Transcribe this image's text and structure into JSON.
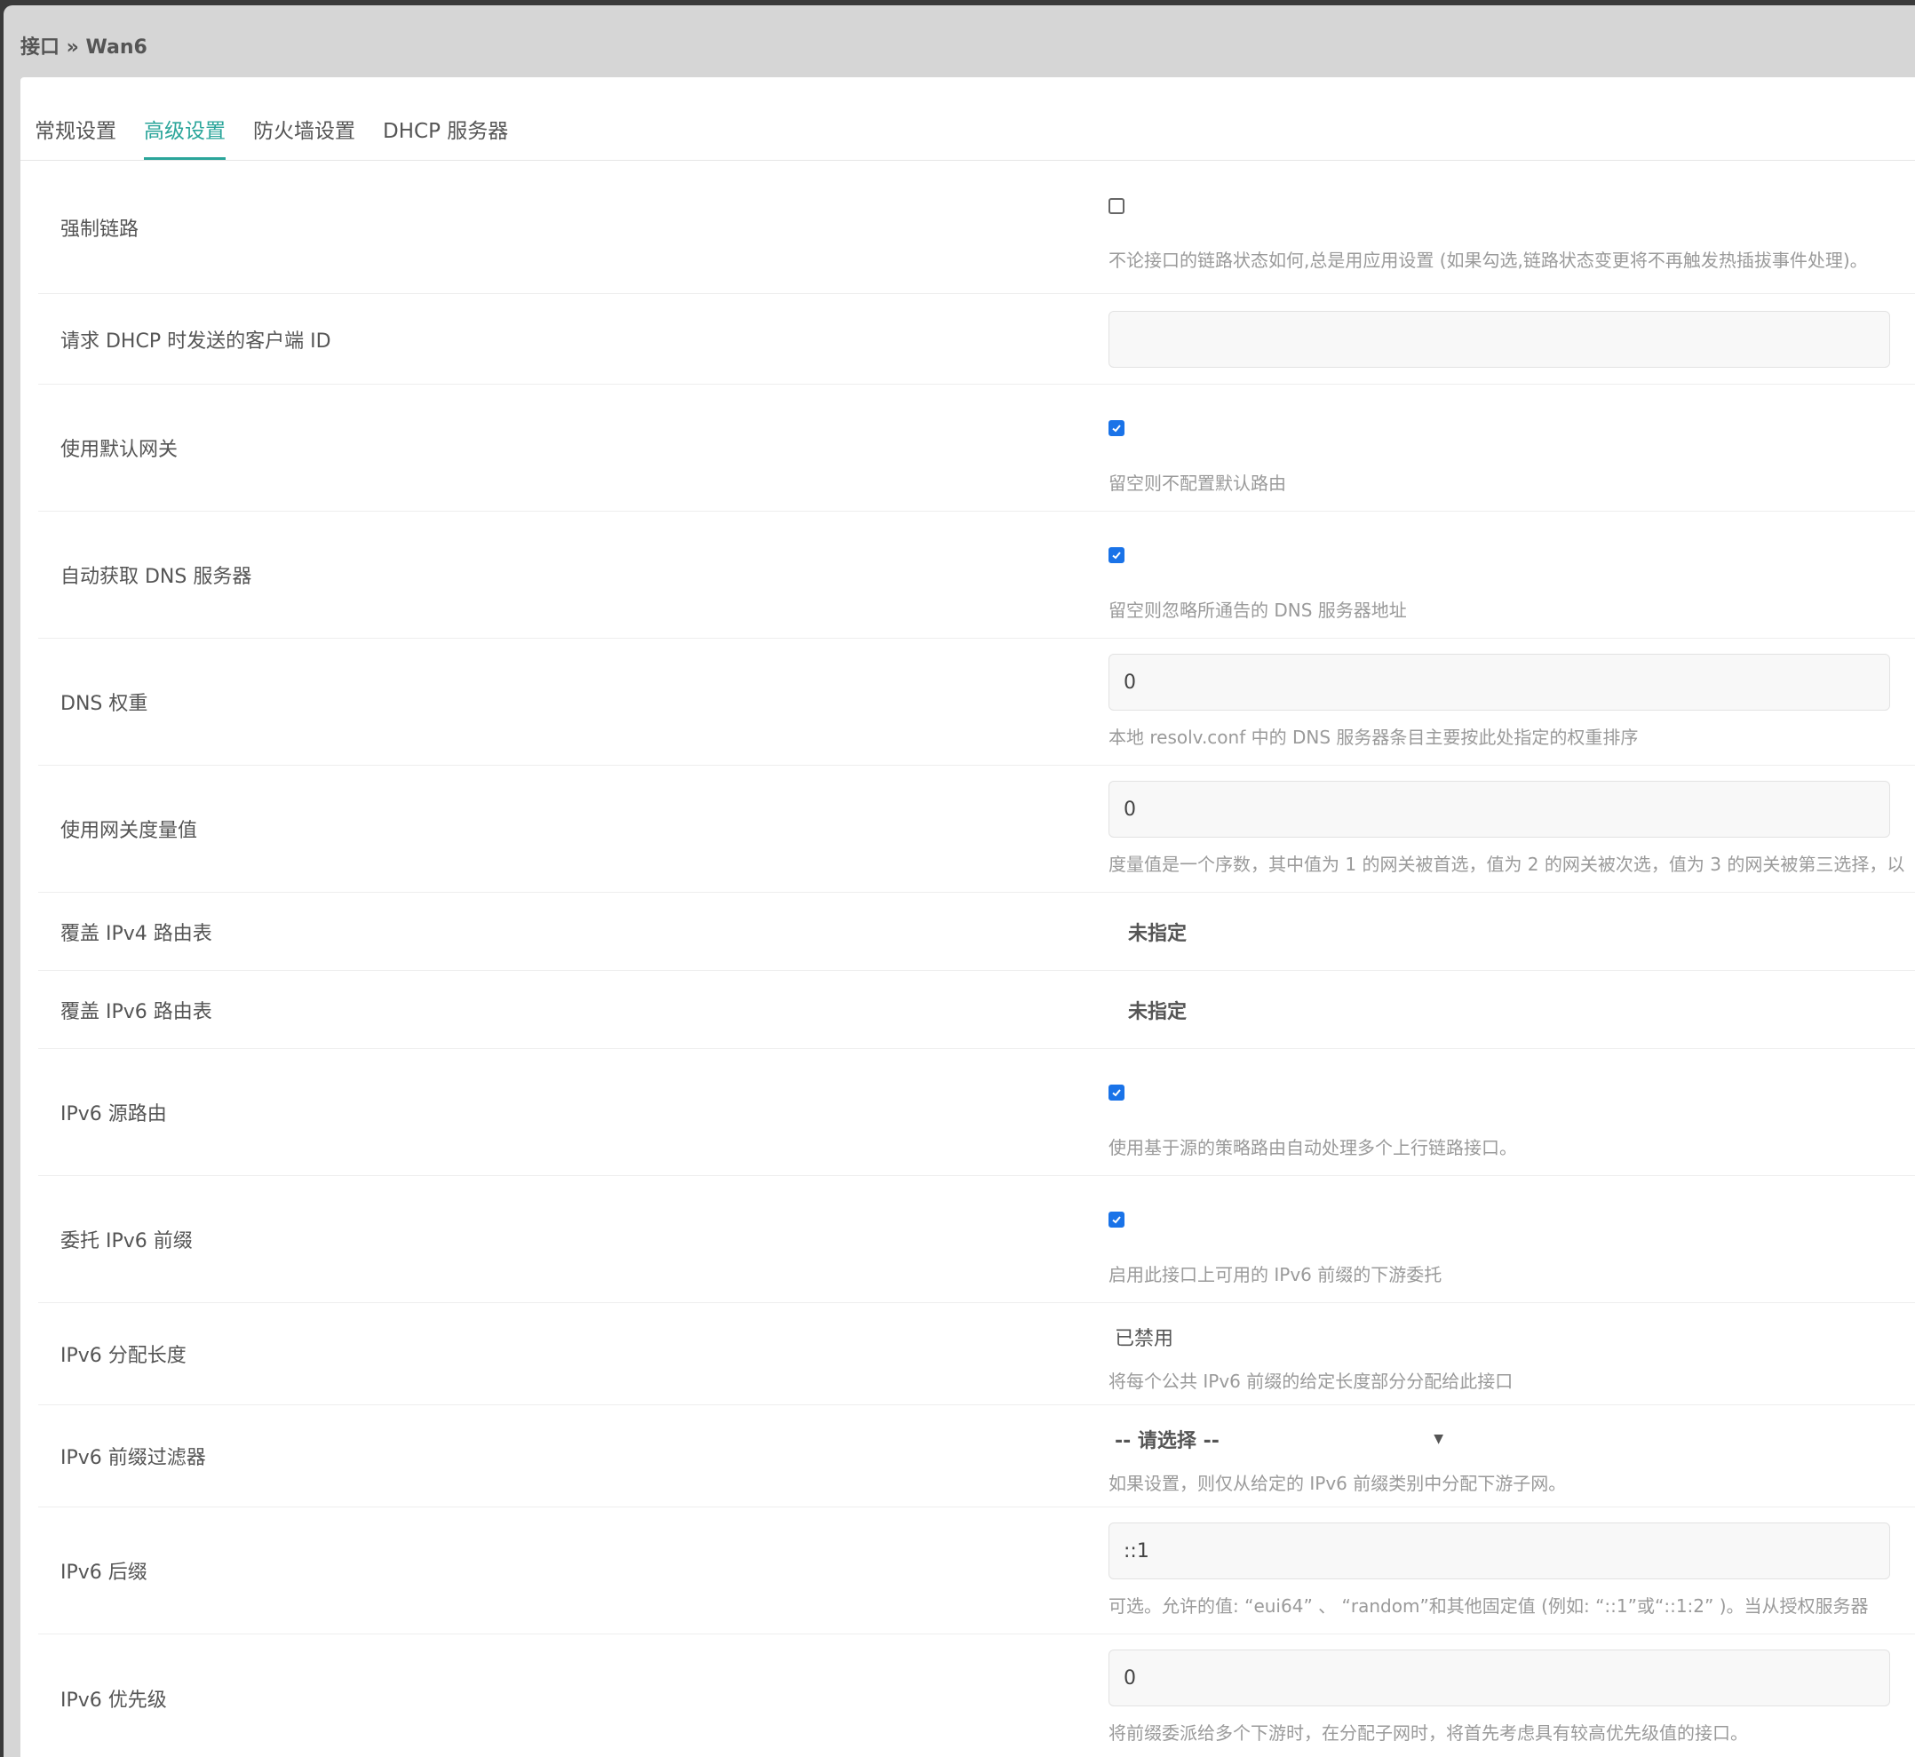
{
  "header": {
    "breadcrumb": "接口 » Wan6"
  },
  "tabs": [
    {
      "label": "常规设置"
    },
    {
      "label": "高级设置"
    },
    {
      "label": "防火墙设置"
    },
    {
      "label": "DHCP 服务器"
    }
  ],
  "active_tab": "高级设置",
  "rows": {
    "force_link": {
      "label": "强制链路",
      "checked": false,
      "desc": "不论接口的链路状态如何,总是用应用设置 (如果勾选,链路状态变更将不再触发热插拔事件处理)。"
    },
    "client_id": {
      "label": "请求 DHCP 时发送的客户端 ID",
      "value": ""
    },
    "default_gw": {
      "label": "使用默认网关",
      "checked": true,
      "desc": "留空则不配置默认路由"
    },
    "auto_dns": {
      "label": "自动获取 DNS 服务器",
      "checked": true,
      "desc": "留空则忽略所通告的 DNS 服务器地址"
    },
    "dns_weight": {
      "label": "DNS 权重",
      "value": "0",
      "desc": "本地 resolv.conf 中的 DNS 服务器条目主要按此处指定的权重排序"
    },
    "gw_metric": {
      "label": "使用网关度量值",
      "value": "0",
      "desc": "度量值是一个序数，其中值为 1 的网关被首选，值为 2 的网关被次选，值为 3 的网关被第三选择，以"
    },
    "ipv4_table": {
      "label": "覆盖 IPv4 路由表",
      "value": "未指定"
    },
    "ipv6_table": {
      "label": "覆盖 IPv6 路由表",
      "value": "未指定"
    },
    "ipv6_src_route": {
      "label": "IPv6 源路由",
      "checked": true,
      "desc": "使用基于源的策略路由自动处理多个上行链路接口。"
    },
    "delegate_prefix": {
      "label": "委托 IPv6 前缀",
      "checked": true,
      "desc": "启用此接口上可用的 IPv6 前缀的下游委托"
    },
    "assign_len": {
      "label": "IPv6 分配长度",
      "value": "已禁用",
      "desc": "将每个公共 IPv6 前缀的给定长度部分分配给此接口"
    },
    "prefix_filter": {
      "label": "IPv6 前缀过滤器",
      "value": "-- 请选择 --",
      "desc": "如果设置，则仅从给定的 IPv6 前缀类别中分配下游子网。"
    },
    "ipv6_suffix": {
      "label": "IPv6 后缀",
      "value": "::1",
      "desc": "可选。允许的值: “eui64” 、 “random”和其他固定值 (例如: “::1”或“::1:2” )。当从授权服务器"
    },
    "ipv6_priority": {
      "label": "IPv6 优先级",
      "value": "0",
      "desc": "将前缀委派给多个下游时，在分配子网时，将首先考虑具有较高优先级值的接口。"
    }
  },
  "colors": {
    "accent": "#2aa59a",
    "checkbox": "#1a73e8"
  }
}
